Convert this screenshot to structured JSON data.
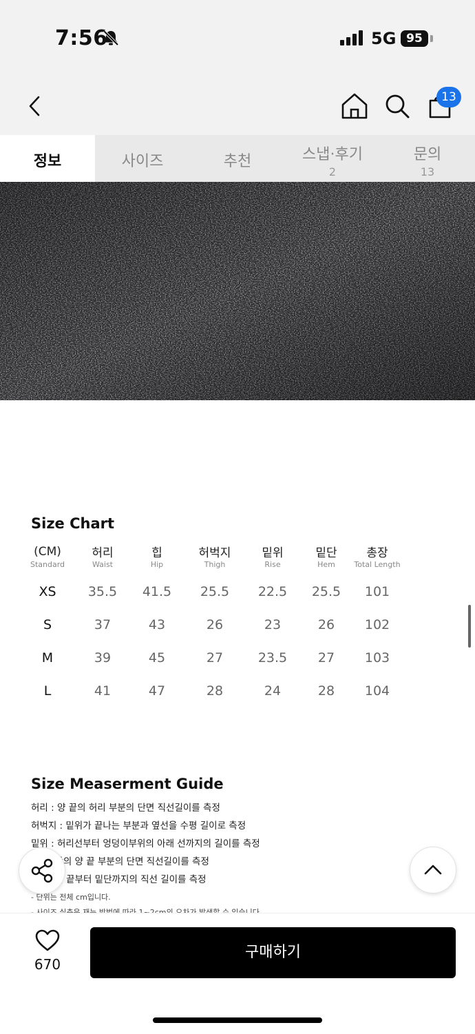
{
  "status": {
    "time": "7:56",
    "network": "5G",
    "battery": "95"
  },
  "header": {
    "cart_count": "13"
  },
  "tabs": [
    {
      "label": "정보",
      "count": ""
    },
    {
      "label": "사이즈",
      "count": ""
    },
    {
      "label": "추천",
      "count": ""
    },
    {
      "label": "스냅·후기",
      "count": "2"
    },
    {
      "label": "문의",
      "count": "13"
    }
  ],
  "size_chart": {
    "title": "Size Chart",
    "columns": [
      {
        "ko": "(CM)",
        "en": "Standard"
      },
      {
        "ko": "허리",
        "en": "Waist"
      },
      {
        "ko": "힙",
        "en": "Hip"
      },
      {
        "ko": "허벅지",
        "en": "Thigh"
      },
      {
        "ko": "밑위",
        "en": "Rise"
      },
      {
        "ko": "밑단",
        "en": "Hem"
      },
      {
        "ko": "총장",
        "en": "Total Length"
      }
    ],
    "rows": [
      [
        "XS",
        "35.5",
        "41.5",
        "25.5",
        "22.5",
        "25.5",
        "101"
      ],
      [
        "S",
        "37",
        "43",
        "26",
        "23",
        "26",
        "102"
      ],
      [
        "M",
        "39",
        "45",
        "27",
        "23.5",
        "27",
        "103"
      ],
      [
        "L",
        "41",
        "47",
        "28",
        "24",
        "28",
        "104"
      ]
    ]
  },
  "guide": {
    "title": "Size Measerment Guide",
    "lines": [
      "허리 : 양 끝의 허리 부분의 단면 직선길이를 측정",
      "허벅지 : 밑위가 끝나는 부분과 옆선을 수평 길이로 측정",
      "밑위 : 허리선부터 엉덩이부위의 아래 선까지의 길이를 측정",
      "밑단의 양 끝 부분의 단면 직선길이를 측정",
      "리의 끝부터 밑단까지의 직선 길이를 측정"
    ],
    "notes": [
      "- 단위는 전체 cm입니다.",
      "- 사이즈 실측은 재는 방법에 따라 1~2cm의 오차가 발생할 수 있습니다."
    ]
  },
  "footer": {
    "like_count": "670",
    "buy_label": "구매하기"
  },
  "colors": {
    "badge": "#1a73e8",
    "buy_button": "#000000"
  }
}
